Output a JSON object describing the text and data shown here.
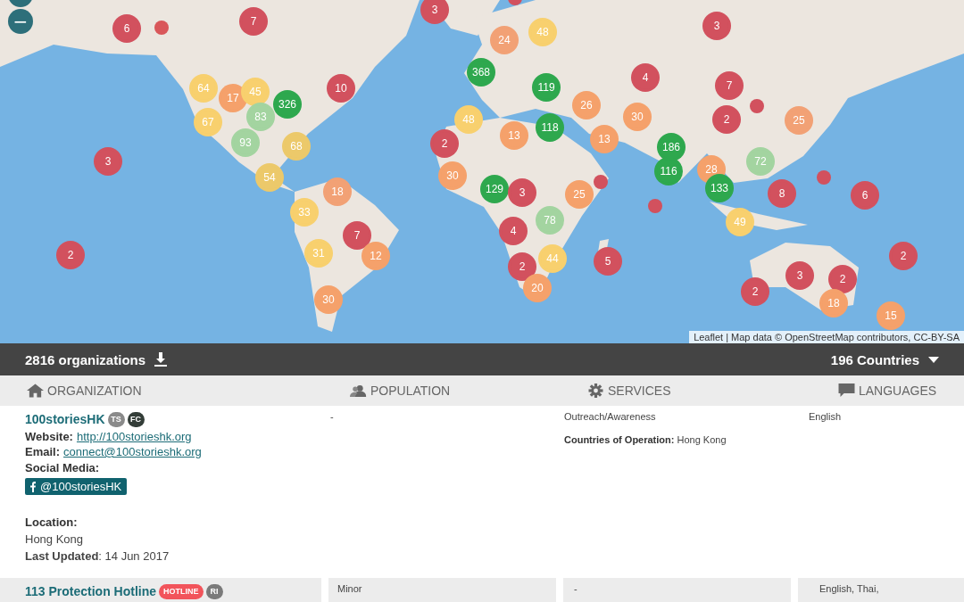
{
  "map": {
    "zoom_out": "−",
    "markers": [
      {
        "kind": "dot",
        "color": "#d2515e"
      },
      {
        "kind": "cluster",
        "label": "6",
        "color": "#d2515e"
      },
      {
        "kind": "dot",
        "color": "#d9575a"
      },
      {
        "kind": "cluster",
        "label": "7",
        "color": "#d2515e"
      },
      {
        "kind": "cluster",
        "label": "3",
        "color": "#d2515e"
      },
      {
        "kind": "cluster",
        "label": "3",
        "color": "#d2515e"
      },
      {
        "kind": "cluster",
        "label": "24",
        "color": "#f2a175"
      },
      {
        "kind": "cluster",
        "label": "48",
        "color": "#f8d06e"
      },
      {
        "kind": "cluster",
        "label": "368",
        "color": "#2ea84e"
      },
      {
        "kind": "cluster",
        "label": "64",
        "color": "#f8d06e"
      },
      {
        "kind": "cluster",
        "label": "17",
        "color": "#f5a16b"
      },
      {
        "kind": "cluster",
        "label": "45",
        "color": "#f8d06e"
      },
      {
        "kind": "cluster",
        "label": "326",
        "color": "#2ea84e"
      },
      {
        "kind": "cluster",
        "label": "83",
        "color": "#a3d4a0"
      },
      {
        "kind": "cluster",
        "label": "67",
        "color": "#f8d06e"
      },
      {
        "kind": "cluster",
        "label": "10",
        "color": "#d2515e"
      },
      {
        "kind": "cluster",
        "label": "93",
        "color": "#a3d4a0"
      },
      {
        "kind": "cluster",
        "label": "68",
        "color": "#ecc96a"
      },
      {
        "kind": "cluster",
        "label": "3",
        "color": "#d2515e"
      },
      {
        "kind": "cluster",
        "label": "54",
        "color": "#ecc96a"
      },
      {
        "kind": "cluster",
        "label": "18",
        "color": "#f2a175"
      },
      {
        "kind": "cluster",
        "label": "33",
        "color": "#f8d06e"
      },
      {
        "kind": "cluster",
        "label": "7",
        "color": "#d2515e"
      },
      {
        "kind": "cluster",
        "label": "31",
        "color": "#f8d06e"
      },
      {
        "kind": "cluster",
        "label": "12",
        "color": "#f5a16b"
      },
      {
        "kind": "cluster",
        "label": "30",
        "color": "#f5a16b"
      },
      {
        "kind": "cluster",
        "label": "2",
        "color": "#d2515e"
      },
      {
        "kind": "cluster",
        "label": "48",
        "color": "#f8d06e"
      },
      {
        "kind": "cluster",
        "label": "2",
        "color": "#d2515e"
      },
      {
        "kind": "cluster",
        "label": "30",
        "color": "#f5a16b"
      },
      {
        "kind": "cluster",
        "label": "119",
        "color": "#2ea84e"
      },
      {
        "kind": "cluster",
        "label": "4",
        "color": "#d2515e"
      },
      {
        "kind": "cluster",
        "label": "7",
        "color": "#d2515e"
      },
      {
        "kind": "cluster",
        "label": "26",
        "color": "#f5a16b"
      },
      {
        "kind": "cluster",
        "label": "30",
        "color": "#f5a16b"
      },
      {
        "kind": "cluster",
        "label": "118",
        "color": "#2ea84e"
      },
      {
        "kind": "cluster",
        "label": "13",
        "color": "#f5a16b"
      },
      {
        "kind": "cluster",
        "label": "13",
        "color": "#f5a16b"
      },
      {
        "kind": "cluster",
        "label": "2",
        "color": "#d2515e"
      },
      {
        "kind": "dot",
        "color": "#d2515e"
      },
      {
        "kind": "cluster",
        "label": "25",
        "color": "#f2a175"
      },
      {
        "kind": "cluster",
        "label": "186",
        "color": "#2ea84e"
      },
      {
        "kind": "cluster",
        "label": "116",
        "color": "#2ea84e"
      },
      {
        "kind": "cluster",
        "label": "28",
        "color": "#f5a16b"
      },
      {
        "kind": "cluster",
        "label": "72",
        "color": "#a3d4a0"
      },
      {
        "kind": "cluster",
        "label": "129",
        "color": "#2ea84e"
      },
      {
        "kind": "cluster",
        "label": "3",
        "color": "#d2515e"
      },
      {
        "kind": "dot",
        "color": "#d2515e"
      },
      {
        "kind": "cluster",
        "label": "25",
        "color": "#f5a16b"
      },
      {
        "kind": "cluster",
        "label": "133",
        "color": "#2ea84e"
      },
      {
        "kind": "dot",
        "color": "#d2515e"
      },
      {
        "kind": "cluster",
        "label": "8",
        "color": "#d2515e"
      },
      {
        "kind": "dot",
        "color": "#d2515e"
      },
      {
        "kind": "cluster",
        "label": "6",
        "color": "#d2515e"
      },
      {
        "kind": "cluster",
        "label": "78",
        "color": "#a3d4a0"
      },
      {
        "kind": "cluster",
        "label": "4",
        "color": "#d2515e"
      },
      {
        "kind": "cluster",
        "label": "49",
        "color": "#f8d06e"
      },
      {
        "kind": "cluster",
        "label": "44",
        "color": "#f8d06e"
      },
      {
        "kind": "cluster",
        "label": "5",
        "color": "#d2515e"
      },
      {
        "kind": "cluster",
        "label": "2",
        "color": "#d2515e"
      },
      {
        "kind": "cluster",
        "label": "20",
        "color": "#f5a16b"
      },
      {
        "kind": "cluster",
        "label": "3",
        "color": "#d2515e"
      },
      {
        "kind": "cluster",
        "label": "2",
        "color": "#d2515e"
      },
      {
        "kind": "cluster",
        "label": "2",
        "color": "#d2515e"
      },
      {
        "kind": "cluster",
        "label": "2",
        "color": "#d2515e"
      },
      {
        "kind": "cluster",
        "label": "18",
        "color": "#f5a16b"
      },
      {
        "kind": "cluster",
        "label": "15",
        "color": "#f5a16b"
      }
    ],
    "attribution_link": "Leaflet",
    "attribution": "| Map data © OpenStreetMap contributors, CC-BY-SA"
  },
  "summary_bar": {
    "count": "2816 organizations",
    "countries": "196 Countries"
  },
  "table": {
    "columns": [
      {
        "label": "ORGANIZATION",
        "kind": "home"
      },
      {
        "label": "POPULATION",
        "kind": "users"
      },
      {
        "label": "SERVICES",
        "kind": "gear"
      },
      {
        "label": "LANGUAGES",
        "kind": "comment"
      }
    ],
    "rows": [
      {
        "name": "100storiesHK",
        "badges": [
          {
            "label": "TS",
            "color": "#8a8a8a"
          },
          {
            "label": "FC",
            "color": "#333d38"
          }
        ],
        "details": [
          {
            "label": "Website:",
            "link": "http://100storieshk.org"
          },
          {
            "label": "Email:",
            "link": "connect@100storieshk.org"
          }
        ],
        "social_label": "Social Media:",
        "facebook": "@100storiesHK",
        "location_label": "Location:",
        "location": "Hong Kong",
        "updated": "**Last Updated**: 14 Jun 2017",
        "population": "-",
        "services": "Outreach/Awareness",
        "operation": "**Countries of Operation:** Hong Kong",
        "languages": "English"
      },
      {
        "name": "113 Protection Hotline",
        "badges": [
          {
            "label": "HOTLINE",
            "color": "#f2545b"
          },
          {
            "label": "RI",
            "color": "#7a7a7a"
          }
        ],
        "population": "Minor",
        "services": "-",
        "languages": "English, Thai,"
      }
    ]
  }
}
